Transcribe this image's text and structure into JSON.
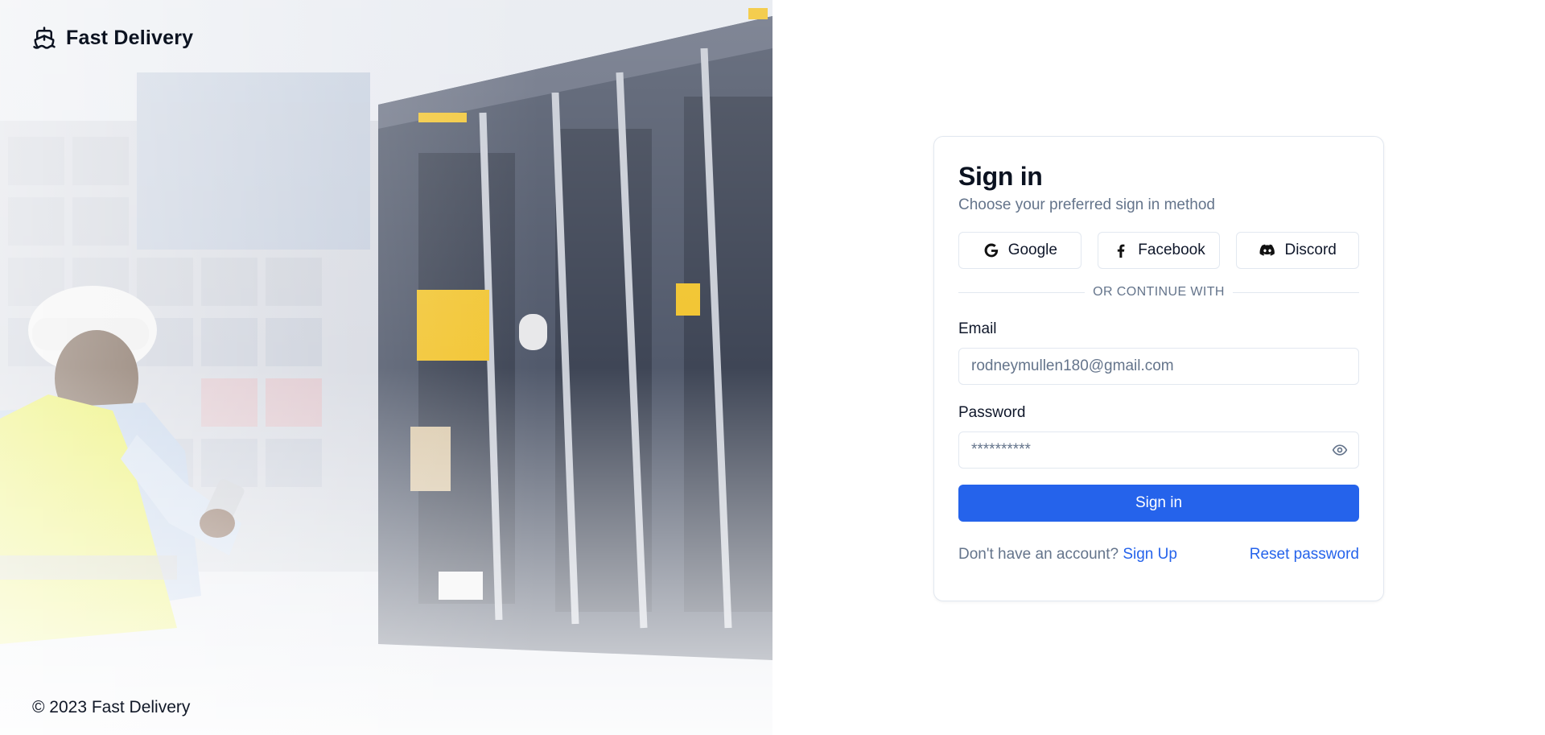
{
  "brand": {
    "name": "Fast Delivery",
    "icon": "ship-icon"
  },
  "footer": {
    "copyright": "© 2023 Fast Delivery"
  },
  "signin": {
    "title": "Sign in",
    "subtitle": "Choose your preferred sign in method",
    "social": [
      {
        "label": "Google",
        "icon": "google-icon"
      },
      {
        "label": "Facebook",
        "icon": "facebook-icon"
      },
      {
        "label": "Discord",
        "icon": "discord-icon"
      }
    ],
    "divider": "OR CONTINUE WITH",
    "email": {
      "label": "Email",
      "placeholder": "rodneymullen180@gmail.com"
    },
    "password": {
      "label": "Password",
      "placeholder": "**********",
      "toggle_icon": "eye-icon"
    },
    "submit_label": "Sign in",
    "no_account_text": "Don't have an account?",
    "signup_link": "Sign Up",
    "reset_link": "Reset password"
  },
  "colors": {
    "primary": "#2563eb",
    "muted": "#64748b",
    "border": "#e2e8f0"
  }
}
